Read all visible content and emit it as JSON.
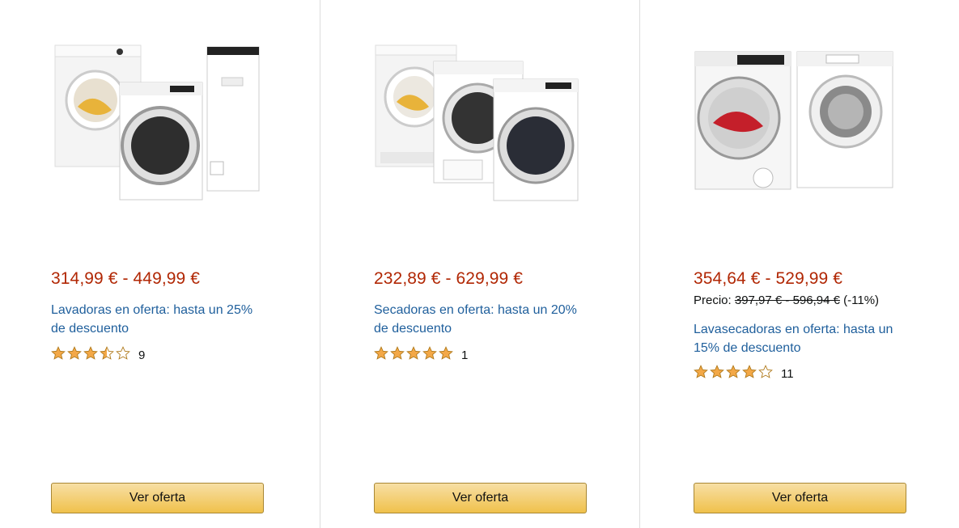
{
  "cards": [
    {
      "price": "314,99 € - 449,99 €",
      "title_line1": "Lavadoras en oferta: hasta un 25%",
      "title_line2": "de descuento",
      "rating": 3.5,
      "review_count": "9",
      "button_label": "Ver oferta"
    },
    {
      "price": "232,89 € - 629,99 €",
      "title_line1": "Secadoras en oferta: hasta un 20%",
      "title_line2": "de descuento",
      "rating": 5,
      "review_count": "1",
      "button_label": "Ver oferta"
    },
    {
      "price": "354,64 € - 529,99 €",
      "was_label": "Precio:",
      "was_price": "397,97 € - 596,94 €",
      "discount": "(-11%)",
      "title_line1": "Lavasecadoras en oferta: hasta un",
      "title_line2": "15% de descuento",
      "rating": 4,
      "review_count": "11",
      "button_label": "Ver oferta"
    }
  ],
  "colors": {
    "price": "#b12704",
    "link": "#1f5f9c",
    "star": "#f3a847",
    "button_top": "#f7dfa5",
    "button_bottom": "#f0c14b"
  }
}
